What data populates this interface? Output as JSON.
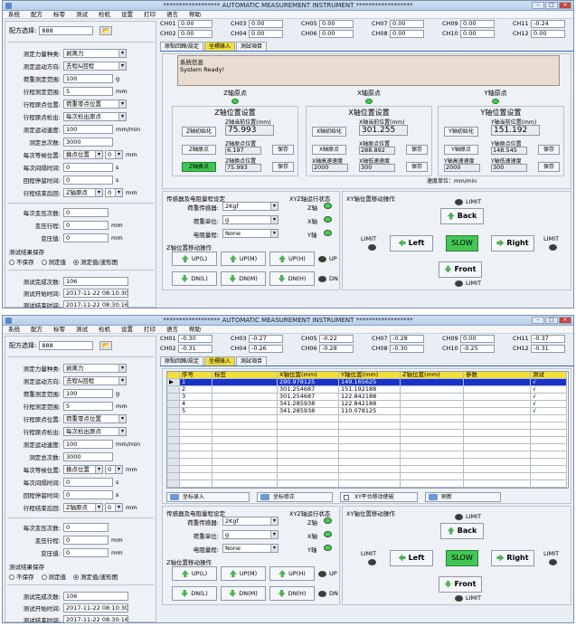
{
  "window": {
    "title": "****************** AUTOMATIC MEASUREMENT INSTRUMENT ******************"
  },
  "menu": [
    "系统",
    "配方",
    "标零",
    "测试",
    "检机",
    "设置",
    "打印",
    "语言",
    "帮助"
  ],
  "recipe": {
    "label": "配方选择:",
    "value": "888",
    "browse": "📂"
  },
  "params": [
    {
      "label": "测定力量种类:",
      "value": "剥离力",
      "type": "dd",
      "unit": ""
    },
    {
      "label": "测定运动方向:",
      "value": "去程&回程",
      "type": "dd",
      "unit": ""
    },
    {
      "label": "荷重测定范围:",
      "value": "100",
      "type": "tb",
      "unit": "g"
    },
    {
      "label": "行程测定范围:",
      "value": "5",
      "type": "tb",
      "unit": "mm"
    },
    {
      "label": "行程原点位置:",
      "value": "荷重零点位置",
      "type": "dd",
      "unit": ""
    },
    {
      "label": "行程原点检出:",
      "value": "每次检出原点",
      "type": "dd",
      "unit": ""
    },
    {
      "label": "测定运动速度:",
      "value": "100",
      "type": "tb",
      "unit": "mm/min"
    },
    {
      "label": "测定总次数:",
      "value": "3000",
      "type": "tb",
      "unit": ""
    }
  ],
  "wait": {
    "label": "每次等候位置:",
    "value": "换点位置",
    "num": "0",
    "unit": "mm"
  },
  "interval": {
    "label": "每次间隔时间:",
    "value": "0",
    "unit": "s"
  },
  "returnwait": {
    "label": "回程停留时间:",
    "value": "0",
    "unit": "s"
  },
  "retzero": {
    "label": "行程结束后回:",
    "value": "Z轴原点",
    "num": "0",
    "unit": "mm"
  },
  "vari": [
    {
      "label": "每次变压次数:",
      "value": "0",
      "unit": ""
    },
    {
      "label": "变压行程:",
      "value": "0",
      "unit": "mm"
    },
    {
      "label": "变压值:",
      "value": "0",
      "unit": "mm"
    }
  ],
  "save": {
    "title": "测试结果保存",
    "opts": [
      "不保存",
      "测定值",
      "测定值/波形图"
    ]
  },
  "stats": [
    {
      "label": "测试完成次数:",
      "value": "106"
    },
    {
      "label": "测试开始时间:",
      "value": "2017-11-22 08:10:30"
    },
    {
      "label": "测试结束时间:",
      "value": "2017-11-22 08:30:16"
    }
  ],
  "channels": {
    "labels": [
      "CH01",
      "CH02",
      "CH03",
      "CH04",
      "CH05",
      "CH06",
      "CH07",
      "CH08",
      "CH09",
      "CH10",
      "CH11",
      "CH12"
    ],
    "s1": [
      "0.00",
      "0.00",
      "0.00",
      "0.00",
      "0.00",
      "0.00",
      "0.00",
      "0.00",
      "0.00",
      "0.00",
      "-0.24",
      "0.00"
    ],
    "s2": [
      "-0.30",
      "-0.31",
      "-0.27",
      "-0.26",
      "-0.22",
      "-0.28",
      "-0.28",
      "-0.30",
      "0.00",
      "-0.25",
      "-0.37",
      "-0.31"
    ]
  },
  "tabs": [
    "原點回歸/設定",
    "坐標錄入",
    "測試項目"
  ],
  "sys": {
    "title": "系统信息",
    "msg": "System Ready!"
  },
  "axisLabels": [
    "Z轴原点",
    "X轴原点",
    "Y轴原点"
  ],
  "zset": {
    "title": "Z轴位置设置",
    "init": "Z轴初始化",
    "origin": "Z轴原点",
    "lower": "Z轴换点",
    "curlab": "Z轴当前位置(mm)",
    "cur": "75.993",
    "origlab": "Z轴原点位置",
    "orig": "6.197",
    "lowlab": "Z轴换点位置",
    "low": "75.993",
    "save": "保存"
  },
  "xset": {
    "title": "X轴位置设置",
    "init": "X轴初始化",
    "origin": "X轴原点",
    "curlab": "X轴当前位置(mm)",
    "cur": "301.255",
    "origlab": "X轴原点位置",
    "orig": "288.892",
    "hslab": "X轴高速速度",
    "hs": "2000",
    "lslab": "X轴低速速度",
    "ls": "300",
    "save": "保存"
  },
  "yset": {
    "title": "Y轴位置设置",
    "init": "Y轴初始化",
    "origin": "Y轴原点",
    "curlab": "Y轴当前位置(mm)",
    "cur": "151.192",
    "origlab": "Y轴原点位置",
    "orig": "148.545",
    "hslab": "Y轴高速速度",
    "hs": "2000",
    "lslab": "Y轴低速速度",
    "ls": "300",
    "save": "保存"
  },
  "speedunit": "速度单位：mm/min",
  "table": {
    "headers": [
      "序号",
      "标签",
      "X轴位置(mm)",
      "Y轴位置(mm)",
      "Z轴位置(mm)",
      "参数",
      "测试"
    ],
    "rows": [
      [
        "1",
        "",
        "290.978125",
        "149.165625",
        "",
        "",
        "√"
      ],
      [
        "2",
        "",
        "301.254687",
        "151.192188",
        "",
        "",
        "√"
      ],
      [
        "3",
        "",
        "301.254687",
        "122.842188",
        "",
        "",
        "√"
      ],
      [
        "4",
        "",
        "341.285938",
        "122.842188",
        "",
        "",
        "√"
      ],
      [
        "5",
        "",
        "341.285938",
        "110.078125",
        "",
        "",
        "√"
      ]
    ],
    "buttons": [
      "坐标录入",
      "坐标修正",
      "XY平台移动使能",
      "刷新"
    ]
  },
  "sensor": {
    "title": "传感器及电阻量程设定",
    "rows": [
      {
        "label": "荷重传感器:",
        "value": "2Kgf"
      },
      {
        "label": "荷重单位:",
        "value": "g"
      },
      {
        "label": "电阻量程:",
        "value": "None"
      }
    ],
    "axisTitle": "XYZ轴运行状态",
    "axes": [
      "Z轴",
      "X轴",
      "Y轴"
    ],
    "zmove": "Z轴位置移动操作",
    "up": [
      "UP(L)",
      "UP(M)",
      "UP(H)"
    ],
    "dn": [
      "DN(L)",
      "DN(M)",
      "DN(H)"
    ],
    "uplab": "UP",
    "dnlab": "DN"
  },
  "xy": {
    "title": "XY轴位置移动操作",
    "limit": "LIMIT",
    "back": "Back",
    "left": "Left",
    "slow": "SLOW",
    "right": "Right",
    "front": "Front"
  }
}
